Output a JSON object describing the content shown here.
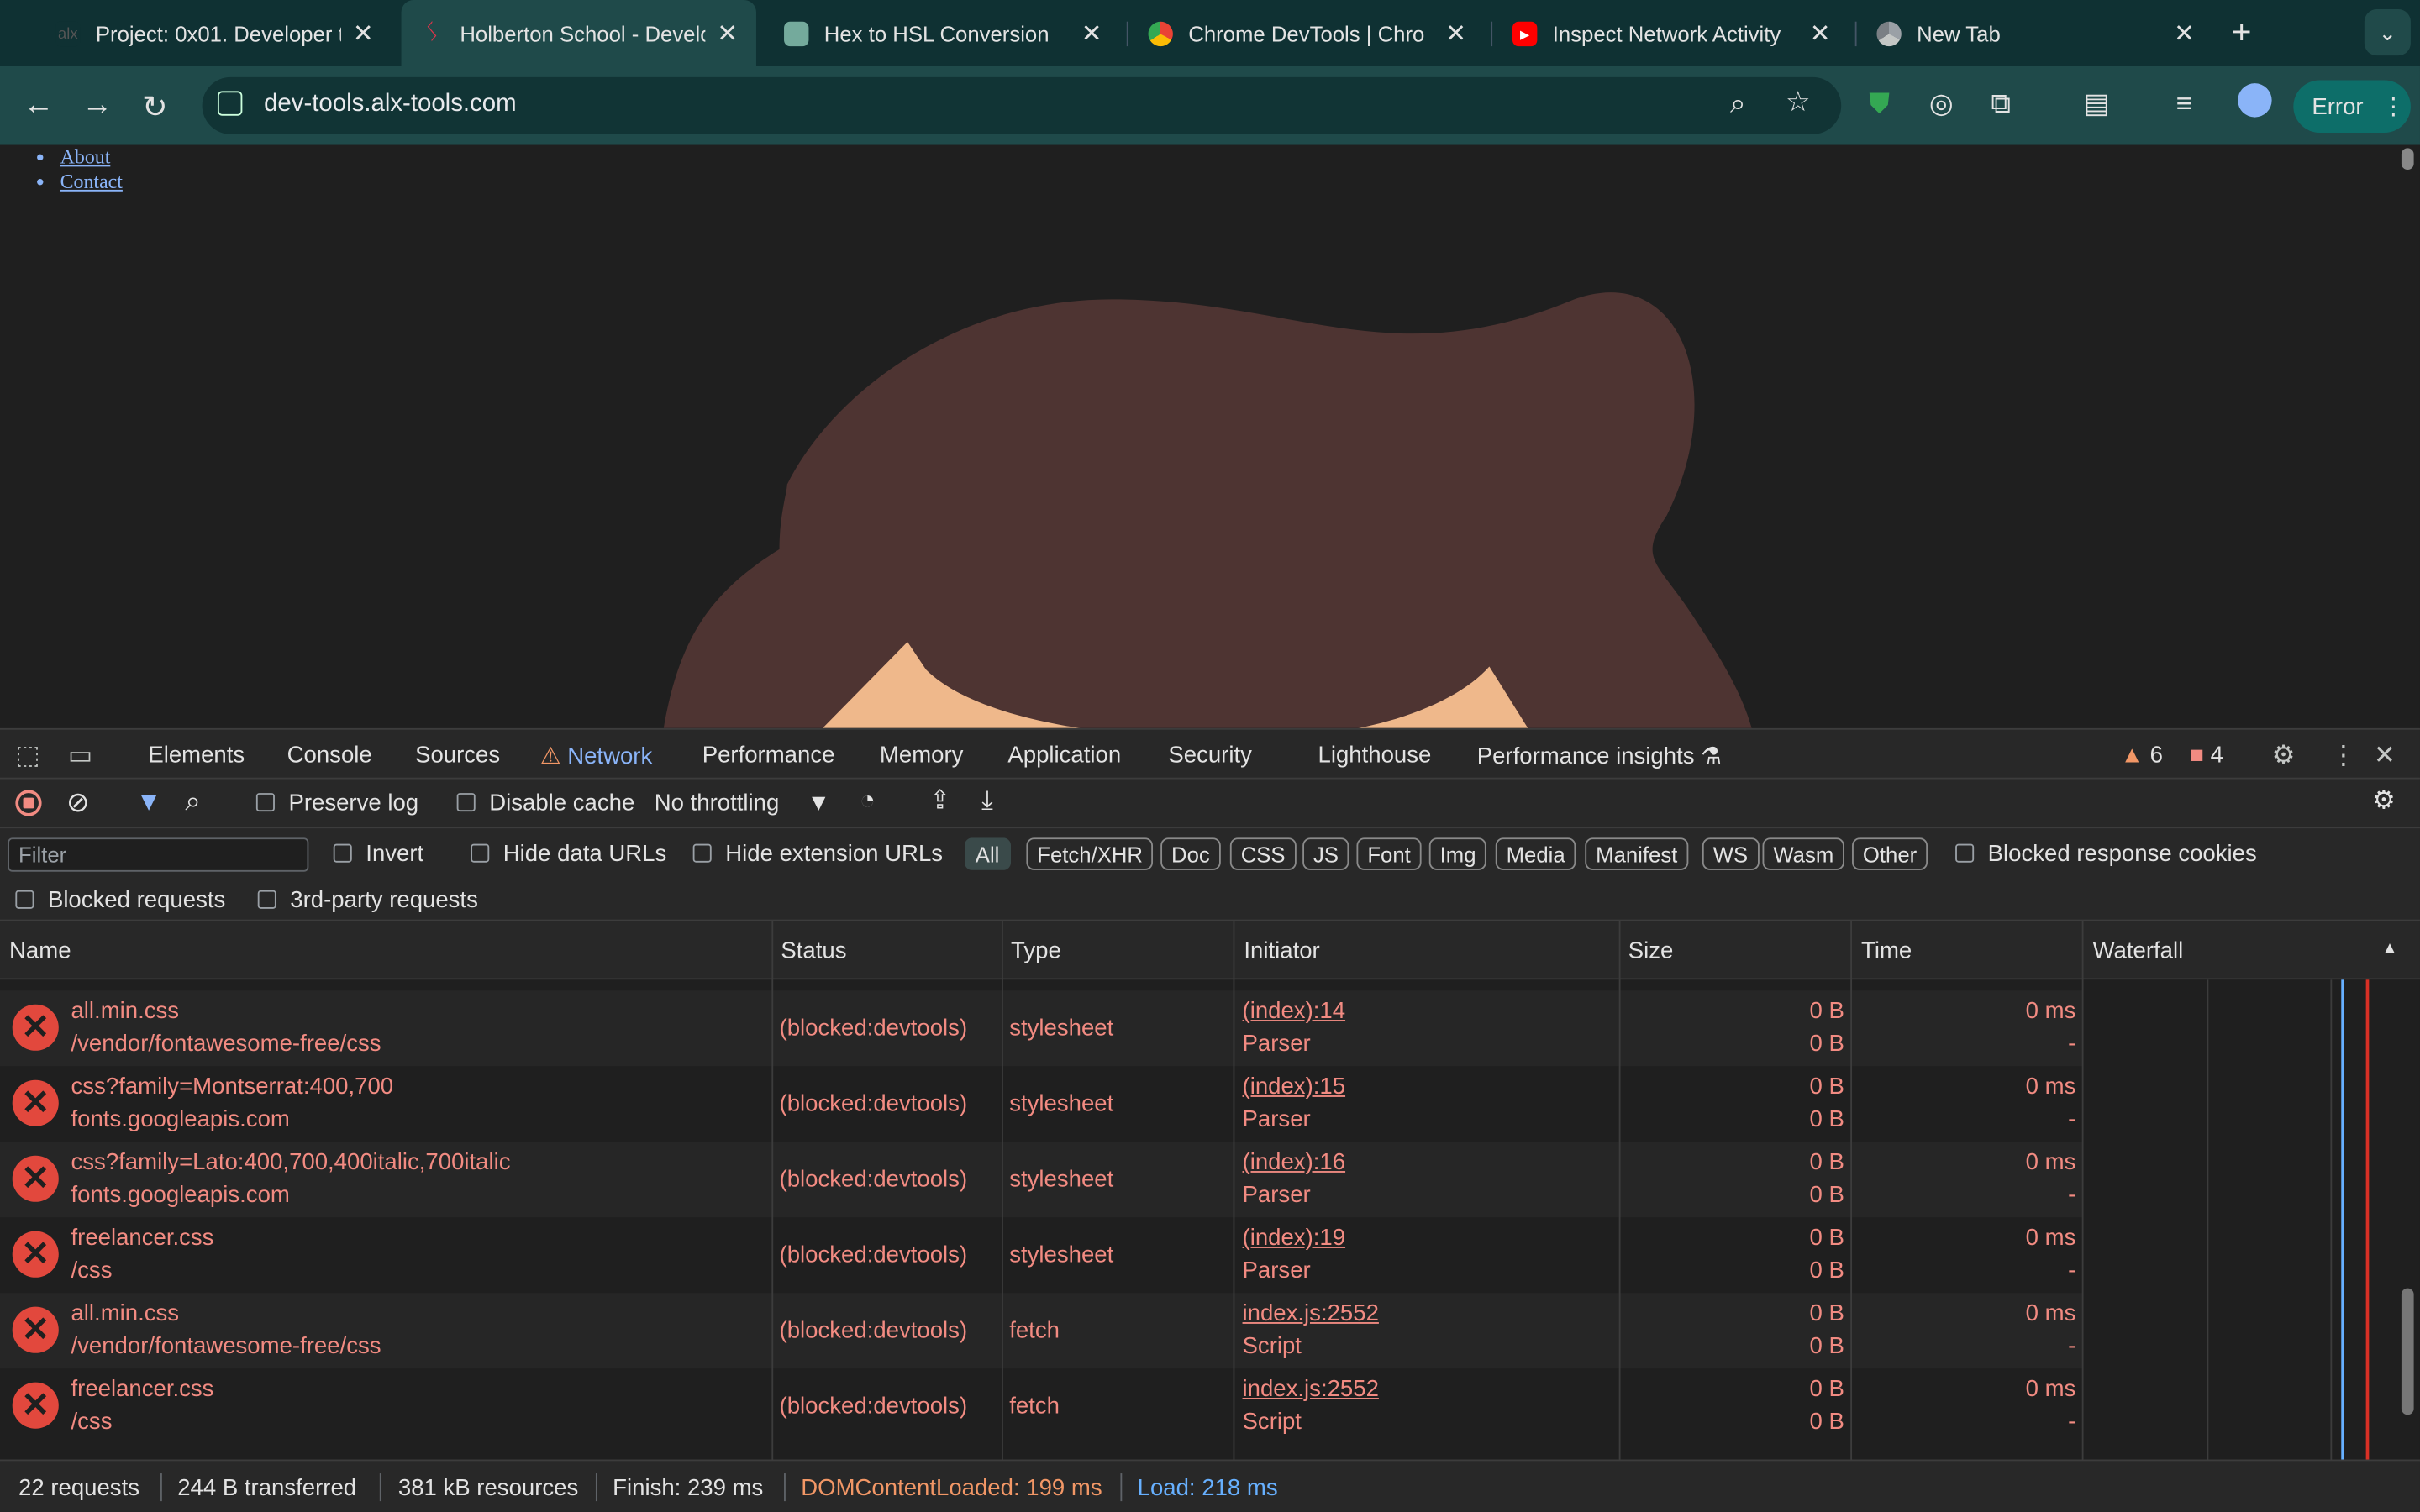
{
  "tabs": [
    {
      "title": "Project: 0x01. Developer t",
      "favicon": "alx-favicon"
    },
    {
      "title": "Holberton School - Develo",
      "favicon": "holberton-favicon"
    },
    {
      "title": "Hex to HSL Conversion",
      "favicon": "chatgpt-favicon"
    },
    {
      "title": "Chrome DevTools | Chro",
      "favicon": "chrome-favicon"
    },
    {
      "title": "Inspect Network Activity",
      "favicon": "youtube-favicon"
    },
    {
      "title": "New Tab",
      "favicon": "chrome-favicon"
    }
  ],
  "address_bar": {
    "url": "dev-tools.alx-tools.com"
  },
  "profile_button": {
    "label": "Error"
  },
  "page": {
    "links": [
      "About",
      "Contact"
    ]
  },
  "devtools": {
    "tabs": [
      "Elements",
      "Console",
      "Sources",
      "Network",
      "Performance",
      "Memory",
      "Application",
      "Security",
      "Lighthouse",
      "Performance insights"
    ],
    "active_tab": "Network",
    "warning_count": "6",
    "error_count": "4",
    "toolbar": {
      "preserve_log": "Preserve log",
      "disable_cache": "Disable cache",
      "throttling": "No throttling"
    },
    "filter": {
      "placeholder": "Filter",
      "invert": "Invert",
      "hide_data_urls": "Hide data URLs",
      "hide_extension_urls": "Hide extension URLs",
      "types": [
        "All",
        "Fetch/XHR",
        "Doc",
        "CSS",
        "JS",
        "Font",
        "Img",
        "Media",
        "Manifest",
        "WS",
        "Wasm",
        "Other"
      ],
      "blocked_response_cookies": "Blocked response cookies",
      "blocked_requests": "Blocked requests",
      "third_party_requests": "3rd-party requests"
    },
    "columns": [
      "Name",
      "Status",
      "Type",
      "Initiator",
      "Size",
      "Time",
      "Waterfall"
    ],
    "rows": [
      {
        "name": "all.min.css",
        "path": "/vendor/fontawesome-free/css",
        "status": "(blocked:devtools)",
        "type": "stylesheet",
        "initiator": "(index):14",
        "initiator_type": "Parser",
        "size1": "0 B",
        "size2": "0 B",
        "time1": "0 ms",
        "time2": "-"
      },
      {
        "name": "css?family=Montserrat:400,700",
        "path": "fonts.googleapis.com",
        "status": "(blocked:devtools)",
        "type": "stylesheet",
        "initiator": "(index):15",
        "initiator_type": "Parser",
        "size1": "0 B",
        "size2": "0 B",
        "time1": "0 ms",
        "time2": "-"
      },
      {
        "name": "css?family=Lato:400,700,400italic,700italic",
        "path": "fonts.googleapis.com",
        "status": "(blocked:devtools)",
        "type": "stylesheet",
        "initiator": "(index):16",
        "initiator_type": "Parser",
        "size1": "0 B",
        "size2": "0 B",
        "time1": "0 ms",
        "time2": "-"
      },
      {
        "name": "freelancer.css",
        "path": "/css",
        "status": "(blocked:devtools)",
        "type": "stylesheet",
        "initiator": "(index):19",
        "initiator_type": "Parser",
        "size1": "0 B",
        "size2": "0 B",
        "time1": "0 ms",
        "time2": "-"
      },
      {
        "name": "all.min.css",
        "path": "/vendor/fontawesome-free/css",
        "status": "(blocked:devtools)",
        "type": "fetch",
        "initiator": "index.js:2552",
        "initiator_type": "Script",
        "size1": "0 B",
        "size2": "0 B",
        "time1": "0 ms",
        "time2": "-"
      },
      {
        "name": "freelancer.css",
        "path": "/css",
        "status": "(blocked:devtools)",
        "type": "fetch",
        "initiator": "index.js:2552",
        "initiator_type": "Script",
        "size1": "0 B",
        "size2": "0 B",
        "time1": "0 ms",
        "time2": "-"
      }
    ],
    "status_bar": {
      "requests": "22 requests",
      "transferred": "244 B transferred",
      "resources": "381 kB resources",
      "finish": "Finish: 239 ms",
      "dom_content_loaded": "DOMContentLoaded: 199 ms",
      "load": "Load: 218 ms"
    }
  },
  "colors": {
    "accent": "#8ab4f8",
    "error": "#f28b82",
    "dcl": "#f29766",
    "load": "#67b0ff",
    "hair": "#4e3432",
    "skin": "#efb88b"
  }
}
